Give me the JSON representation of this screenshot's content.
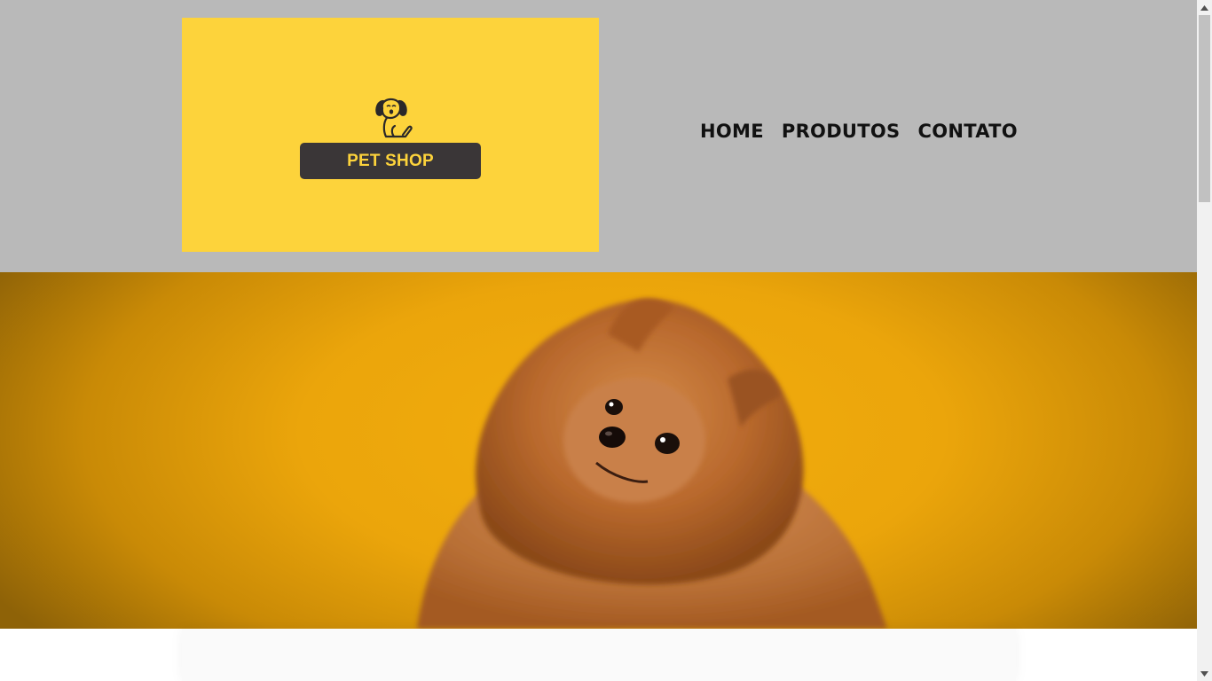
{
  "logo": {
    "text": "PET SHOP",
    "icon": "dog-icon",
    "background_color": "#fdd33b",
    "badge_color": "#3a3637"
  },
  "nav": {
    "items": [
      {
        "label": "HOME"
      },
      {
        "label": "PRODUTOS"
      },
      {
        "label": "CONTATO"
      }
    ]
  },
  "hero": {
    "image": "pomeranian-dog-photo",
    "background_color": "#eba50b"
  },
  "colors": {
    "header_bg": "#b9b9b9",
    "page_bg": "#ffffff"
  },
  "scrollbar": {
    "up_icon": "scroll-up-arrow-icon",
    "down_icon": "scroll-down-arrow-icon"
  }
}
